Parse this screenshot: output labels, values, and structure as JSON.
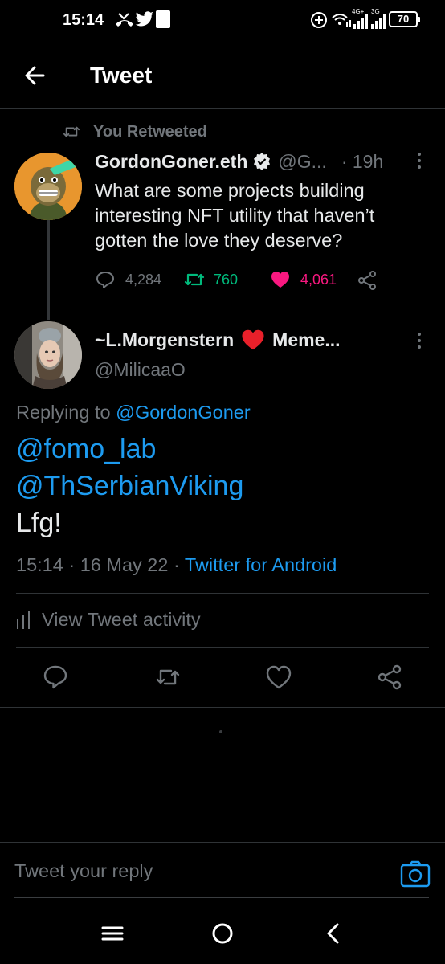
{
  "status_bar": {
    "time": "15:14",
    "battery": "70",
    "net_4g": "4G+",
    "net_3g": "3G",
    "icons": [
      "missed-call-icon",
      "twitter-bird-icon",
      "notification-square-icon",
      "add-circle-icon",
      "wifi-icon",
      "signal-icon",
      "signal-icon",
      "battery-icon"
    ]
  },
  "header": {
    "title": "Tweet",
    "back_icon": "arrow-left-icon"
  },
  "retweet_context": {
    "label": "You Retweeted",
    "icon": "retweet-icon"
  },
  "original_tweet": {
    "name": "GordonGoner.eth",
    "verified": true,
    "handle": "@G...",
    "time": "· 19h",
    "body": "What are some projects building interesting NFT utility that haven’t gotten the love they deserve?",
    "replies": "4,284",
    "retweets": "760",
    "likes": "4,061",
    "liked": true,
    "retweeted": true
  },
  "reply_tweet": {
    "name_prefix": "~L.Morgenstern",
    "name_suffix": "Meme...",
    "handle": "@MilicaaO",
    "replying_to_label": "Replying to",
    "replying_to_handle": "@GordonGoner",
    "mention_1": "@fomo_lab",
    "mention_2": "@ThSerbianViking",
    "text": "Lfg!",
    "time": "15:14",
    "date": "16 May 22",
    "source": "Twitter for Android",
    "sep": "·"
  },
  "activity": {
    "label": "View Tweet activity"
  },
  "actions": [
    "reply-icon",
    "retweet-icon",
    "like-icon",
    "share-icon"
  ],
  "reply_bar": {
    "placeholder": "Tweet your reply"
  },
  "colors": {
    "background": "#000000",
    "text": "#e7e9ea",
    "muted": "#71767b",
    "accent_blue": "#1d9bf0",
    "retweet_green": "#00ba7c",
    "like_pink": "#f91880",
    "divider": "#2f3336"
  }
}
